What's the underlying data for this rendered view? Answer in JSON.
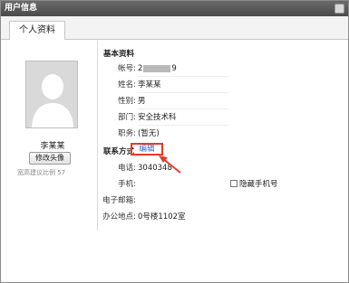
{
  "window": {
    "title": "用户信息"
  },
  "tabs": [
    {
      "label": "个人资料",
      "active": true
    }
  ],
  "profile": {
    "name": "李某某",
    "edit_avatar_label": "修改头像",
    "avatar_hint": "宽高建议比例 57"
  },
  "basic_info": {
    "section_title": "基本资料",
    "fields": [
      {
        "label": "帐号:",
        "value_prefix": "2",
        "value_suffix": "9"
      },
      {
        "label": "姓名:",
        "value": "李某某"
      },
      {
        "label": "性别:",
        "value": "男"
      },
      {
        "label": "部门:",
        "value": "安全技术科"
      },
      {
        "label": "职务:",
        "value": "(暂无)"
      }
    ]
  },
  "contact_info": {
    "section_title": "联系方式",
    "edit_link": "编辑",
    "fields": [
      {
        "label": "电话:",
        "value": "3040348"
      },
      {
        "label": "手机:",
        "value": ""
      },
      {
        "label": "电子邮箱:",
        "value": ""
      },
      {
        "label": "办公地点:",
        "value": "0号楼1102室"
      }
    ],
    "hide_mobile_label": "隐藏手机号"
  },
  "colors": {
    "highlight_red": "#e53b2c",
    "link_blue": "#2b63c8",
    "titlebar": "#555555"
  }
}
